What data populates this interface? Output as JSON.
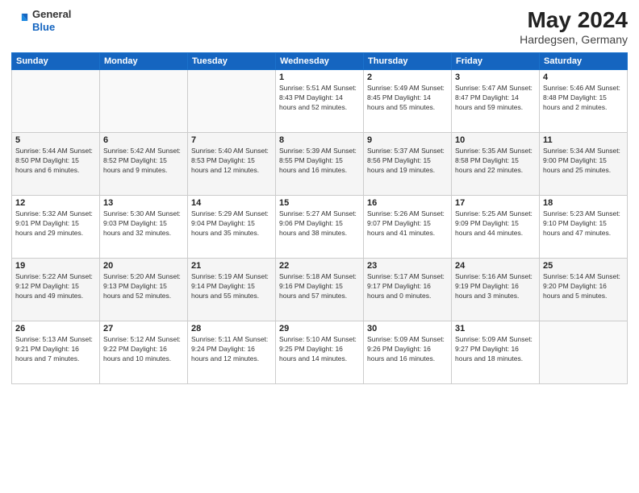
{
  "header": {
    "logo_line1": "General",
    "logo_line2": "Blue",
    "month": "May 2024",
    "location": "Hardegsen, Germany"
  },
  "days_of_week": [
    "Sunday",
    "Monday",
    "Tuesday",
    "Wednesday",
    "Thursday",
    "Friday",
    "Saturday"
  ],
  "weeks": [
    [
      {
        "day": "",
        "info": ""
      },
      {
        "day": "",
        "info": ""
      },
      {
        "day": "",
        "info": ""
      },
      {
        "day": "1",
        "info": "Sunrise: 5:51 AM\nSunset: 8:43 PM\nDaylight: 14 hours and 52 minutes."
      },
      {
        "day": "2",
        "info": "Sunrise: 5:49 AM\nSunset: 8:45 PM\nDaylight: 14 hours and 55 minutes."
      },
      {
        "day": "3",
        "info": "Sunrise: 5:47 AM\nSunset: 8:47 PM\nDaylight: 14 hours and 59 minutes."
      },
      {
        "day": "4",
        "info": "Sunrise: 5:46 AM\nSunset: 8:48 PM\nDaylight: 15 hours and 2 minutes."
      }
    ],
    [
      {
        "day": "5",
        "info": "Sunrise: 5:44 AM\nSunset: 8:50 PM\nDaylight: 15 hours and 6 minutes."
      },
      {
        "day": "6",
        "info": "Sunrise: 5:42 AM\nSunset: 8:52 PM\nDaylight: 15 hours and 9 minutes."
      },
      {
        "day": "7",
        "info": "Sunrise: 5:40 AM\nSunset: 8:53 PM\nDaylight: 15 hours and 12 minutes."
      },
      {
        "day": "8",
        "info": "Sunrise: 5:39 AM\nSunset: 8:55 PM\nDaylight: 15 hours and 16 minutes."
      },
      {
        "day": "9",
        "info": "Sunrise: 5:37 AM\nSunset: 8:56 PM\nDaylight: 15 hours and 19 minutes."
      },
      {
        "day": "10",
        "info": "Sunrise: 5:35 AM\nSunset: 8:58 PM\nDaylight: 15 hours and 22 minutes."
      },
      {
        "day": "11",
        "info": "Sunrise: 5:34 AM\nSunset: 9:00 PM\nDaylight: 15 hours and 25 minutes."
      }
    ],
    [
      {
        "day": "12",
        "info": "Sunrise: 5:32 AM\nSunset: 9:01 PM\nDaylight: 15 hours and 29 minutes."
      },
      {
        "day": "13",
        "info": "Sunrise: 5:30 AM\nSunset: 9:03 PM\nDaylight: 15 hours and 32 minutes."
      },
      {
        "day": "14",
        "info": "Sunrise: 5:29 AM\nSunset: 9:04 PM\nDaylight: 15 hours and 35 minutes."
      },
      {
        "day": "15",
        "info": "Sunrise: 5:27 AM\nSunset: 9:06 PM\nDaylight: 15 hours and 38 minutes."
      },
      {
        "day": "16",
        "info": "Sunrise: 5:26 AM\nSunset: 9:07 PM\nDaylight: 15 hours and 41 minutes."
      },
      {
        "day": "17",
        "info": "Sunrise: 5:25 AM\nSunset: 9:09 PM\nDaylight: 15 hours and 44 minutes."
      },
      {
        "day": "18",
        "info": "Sunrise: 5:23 AM\nSunset: 9:10 PM\nDaylight: 15 hours and 47 minutes."
      }
    ],
    [
      {
        "day": "19",
        "info": "Sunrise: 5:22 AM\nSunset: 9:12 PM\nDaylight: 15 hours and 49 minutes."
      },
      {
        "day": "20",
        "info": "Sunrise: 5:20 AM\nSunset: 9:13 PM\nDaylight: 15 hours and 52 minutes."
      },
      {
        "day": "21",
        "info": "Sunrise: 5:19 AM\nSunset: 9:14 PM\nDaylight: 15 hours and 55 minutes."
      },
      {
        "day": "22",
        "info": "Sunrise: 5:18 AM\nSunset: 9:16 PM\nDaylight: 15 hours and 57 minutes."
      },
      {
        "day": "23",
        "info": "Sunrise: 5:17 AM\nSunset: 9:17 PM\nDaylight: 16 hours and 0 minutes."
      },
      {
        "day": "24",
        "info": "Sunrise: 5:16 AM\nSunset: 9:19 PM\nDaylight: 16 hours and 3 minutes."
      },
      {
        "day": "25",
        "info": "Sunrise: 5:14 AM\nSunset: 9:20 PM\nDaylight: 16 hours and 5 minutes."
      }
    ],
    [
      {
        "day": "26",
        "info": "Sunrise: 5:13 AM\nSunset: 9:21 PM\nDaylight: 16 hours and 7 minutes."
      },
      {
        "day": "27",
        "info": "Sunrise: 5:12 AM\nSunset: 9:22 PM\nDaylight: 16 hours and 10 minutes."
      },
      {
        "day": "28",
        "info": "Sunrise: 5:11 AM\nSunset: 9:24 PM\nDaylight: 16 hours and 12 minutes."
      },
      {
        "day": "29",
        "info": "Sunrise: 5:10 AM\nSunset: 9:25 PM\nDaylight: 16 hours and 14 minutes."
      },
      {
        "day": "30",
        "info": "Sunrise: 5:09 AM\nSunset: 9:26 PM\nDaylight: 16 hours and 16 minutes."
      },
      {
        "day": "31",
        "info": "Sunrise: 5:09 AM\nSunset: 9:27 PM\nDaylight: 16 hours and 18 minutes."
      },
      {
        "day": "",
        "info": ""
      }
    ]
  ]
}
